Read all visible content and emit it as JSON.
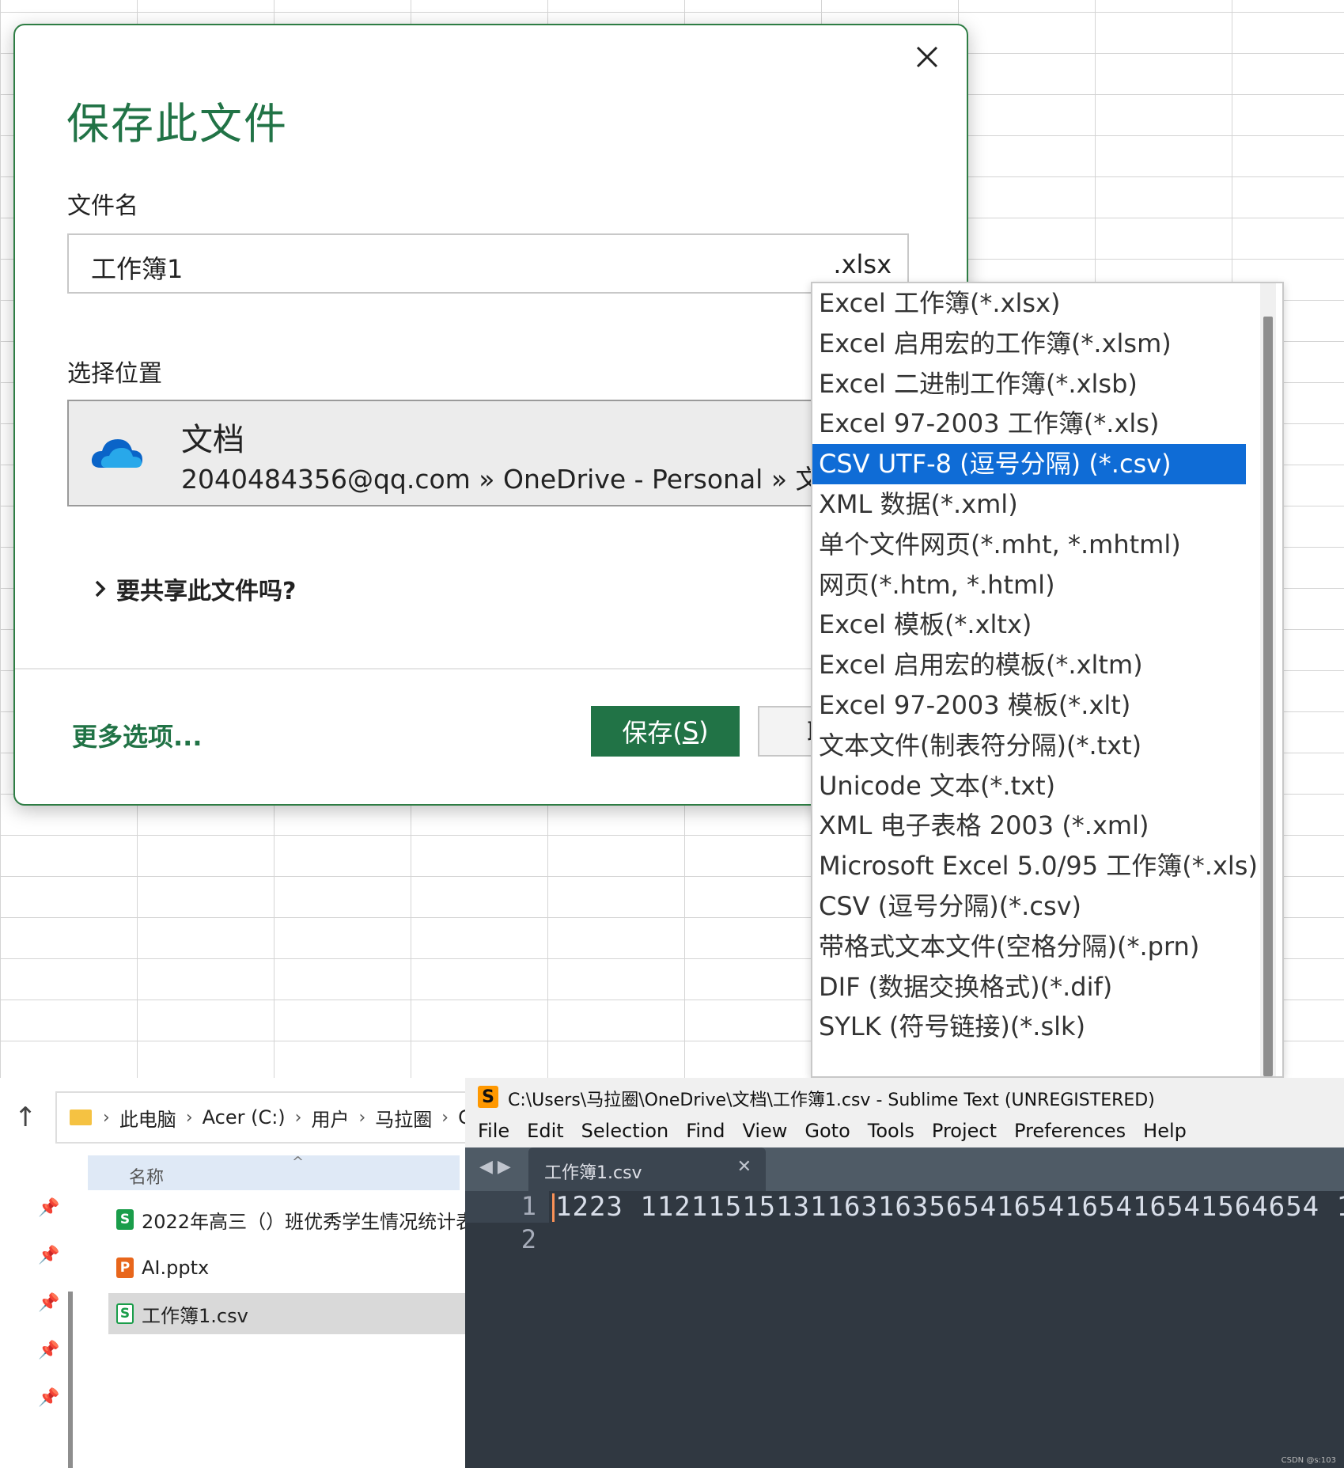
{
  "dialog": {
    "title": "保存此文件",
    "close_glyph": "✕",
    "filename_label": "文件名",
    "filename_value": "工作簿1",
    "filename_ext": ".xlsx",
    "location_label": "选择位置",
    "location_name": "文档",
    "location_path": "2040484356@qq.com » OneDrive - Personal » 文档",
    "share_label": "要共享此文件吗?",
    "more_options": "更多选项...",
    "save_label": "保存(",
    "save_key": "S",
    "save_label_end": ")",
    "cancel_label": "取消",
    "accent": "#217346"
  },
  "filetypes": {
    "selected_index": 4,
    "items": [
      "Excel 工作簿(*.xlsx)",
      "Excel 启用宏的工作簿(*.xlsm)",
      "Excel 二进制工作簿(*.xlsb)",
      "Excel 97-2003 工作簿(*.xls)",
      "CSV UTF-8 (逗号分隔) (*.csv)",
      "XML 数据(*.xml)",
      "单个文件网页(*.mht, *.mhtml)",
      "网页(*.htm, *.html)",
      "Excel 模板(*.xltx)",
      "Excel 启用宏的模板(*.xltm)",
      "Excel 97-2003 模板(*.xlt)",
      "文本文件(制表符分隔)(*.txt)",
      "Unicode 文本(*.txt)",
      "XML 电子表格 2003 (*.xml)",
      "Microsoft Excel 5.0/95 工作簿(*.xls)",
      "CSV (逗号分隔)(*.csv)",
      "带格式文本文件(空格分隔)(*.prn)",
      "DIF (数据交换格式)(*.dif)",
      "SYLK (符号链接)(*.slk)"
    ],
    "highlight_color": "#0f6cd6"
  },
  "explorer": {
    "up_glyph": "↑",
    "breadcrumb": [
      "此电脑",
      "Acer (C:)",
      "用户",
      "马拉圈",
      "C"
    ],
    "column_name": "名称",
    "files": [
      {
        "name": "2022年高三（）班优秀学生情况统计表....",
        "icon": "csv-icon"
      },
      {
        "name": "AI.pptx",
        "icon": "pptx-icon"
      },
      {
        "name": "工作簿1.csv",
        "icon": "csv-icon"
      }
    ]
  },
  "sublime": {
    "title": "C:\\Users\\马拉圈\\OneDrive\\文档\\工作簿1.csv - Sublime Text (UNREGISTERED)",
    "menu": [
      "File",
      "Edit",
      "Selection",
      "Find",
      "View",
      "Goto",
      "Tools",
      "Project",
      "Preferences",
      "Help"
    ],
    "tab_label": "工作簿1.csv",
    "line_numbers": [
      "1",
      "2"
    ],
    "line1": "1223 1121151513116316356541654165416541564654 1"
  },
  "watermark": "CSDN @s:103"
}
